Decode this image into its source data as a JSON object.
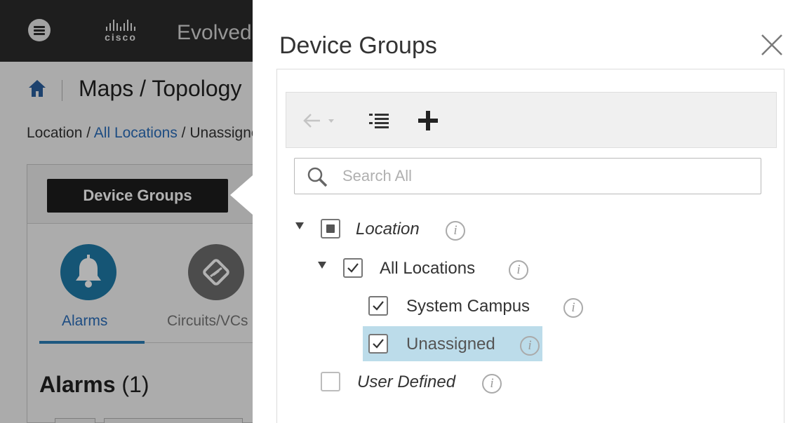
{
  "app": {
    "brand": "cisco",
    "name": "Evolved Programmable Network Manager",
    "page_title": "Maps / Topology",
    "breadcrumb": {
      "root": "Location",
      "sep1": " / ",
      "link": "All Locations",
      "sep2": " / ",
      "current": "Unassigned"
    }
  },
  "left_panel": {
    "device_groups_button": "Device Groups",
    "tabs": [
      {
        "label": "Alarms",
        "icon": "bell-icon",
        "active": true
      },
      {
        "label": "Circuits/VCs",
        "icon": "circuit-icon",
        "active": false
      }
    ],
    "alarms_heading": "Alarms",
    "alarms_count": "(1)"
  },
  "dialog": {
    "title": "Device Groups",
    "close_icon": "close-icon",
    "toolbar": {
      "back_icon": "arrow-left-icon",
      "list_icon": "list-icon",
      "add_icon": "plus-icon"
    },
    "search": {
      "placeholder": "Search All",
      "value": ""
    },
    "tree": [
      {
        "label": "Location",
        "italic": true,
        "state": "partial",
        "expanded": true
      },
      {
        "label": "All Locations",
        "italic": false,
        "state": "checked",
        "expanded": true
      },
      {
        "label": "System Campus",
        "italic": false,
        "state": "checked"
      },
      {
        "label": "Unassigned",
        "italic": false,
        "state": "checked",
        "selected": true
      },
      {
        "label": "User Defined",
        "italic": true,
        "state": "unchecked"
      }
    ],
    "info_glyph": "i"
  },
  "colors": {
    "topbar": "#2b2b2b",
    "link": "#2a6ebb",
    "selected_row": "#bcdcea",
    "alarms_tile": "#1f7aa8"
  }
}
